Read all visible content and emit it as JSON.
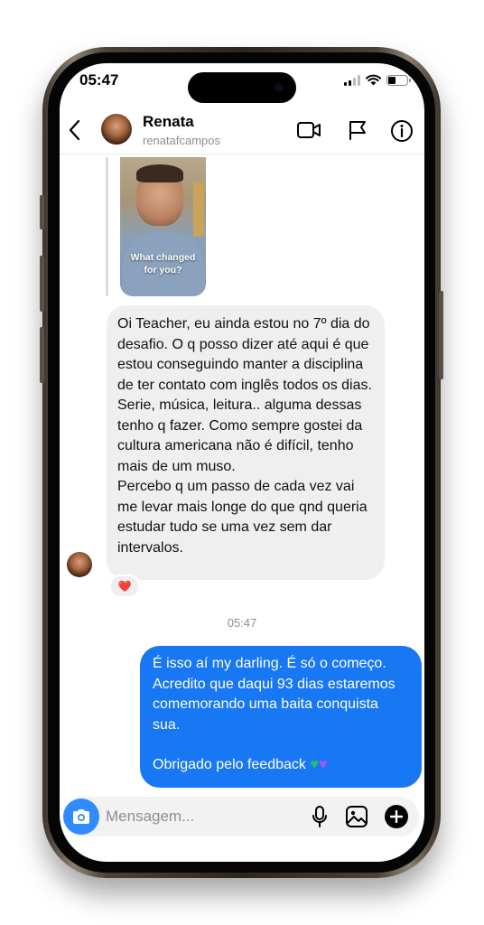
{
  "status_bar": {
    "time": "05:47"
  },
  "header": {
    "name": "Renata",
    "username": "renatafcampos"
  },
  "story_reply": {
    "caption_line1": "What changed",
    "caption_line2": "for you?"
  },
  "incoming_message": {
    "paragraph1": "Oi Teacher, eu ainda estou no 7º dia do desafio. O q posso dizer até aqui é que estou conseguindo manter a disciplina de ter contato com inglês todos os dias. Serie, música, leitura.. alguma dessas tenho q fazer. Como sempre gostei da cultura americana não é difícil, tenho mais de um muso.",
    "paragraph2": "Percebo q um passo de cada vez vai me levar mais longe do que qnd queria estudar tudo se uma vez sem dar intervalos.",
    "reaction": "❤️"
  },
  "timestamp": "05:47",
  "outgoing_message": {
    "paragraph1": "É isso aí my darling. É só o começo. Acredito que daqui 93 dias estaremos comemorando uma baita conquista sua.",
    "paragraph2_text": "Obrigado pelo feedback",
    "heart1": "♥",
    "heart2": "♥"
  },
  "composer": {
    "placeholder": "Mensagem..."
  },
  "colors": {
    "outgoing_bubble": "#1877f2",
    "incoming_bubble": "#efefef",
    "camera_button": "#2f8bff"
  },
  "icons": [
    "back-icon",
    "video-call-icon",
    "flag-icon",
    "info-icon",
    "camera-icon",
    "microphone-icon",
    "gallery-icon",
    "plus-icon"
  ]
}
